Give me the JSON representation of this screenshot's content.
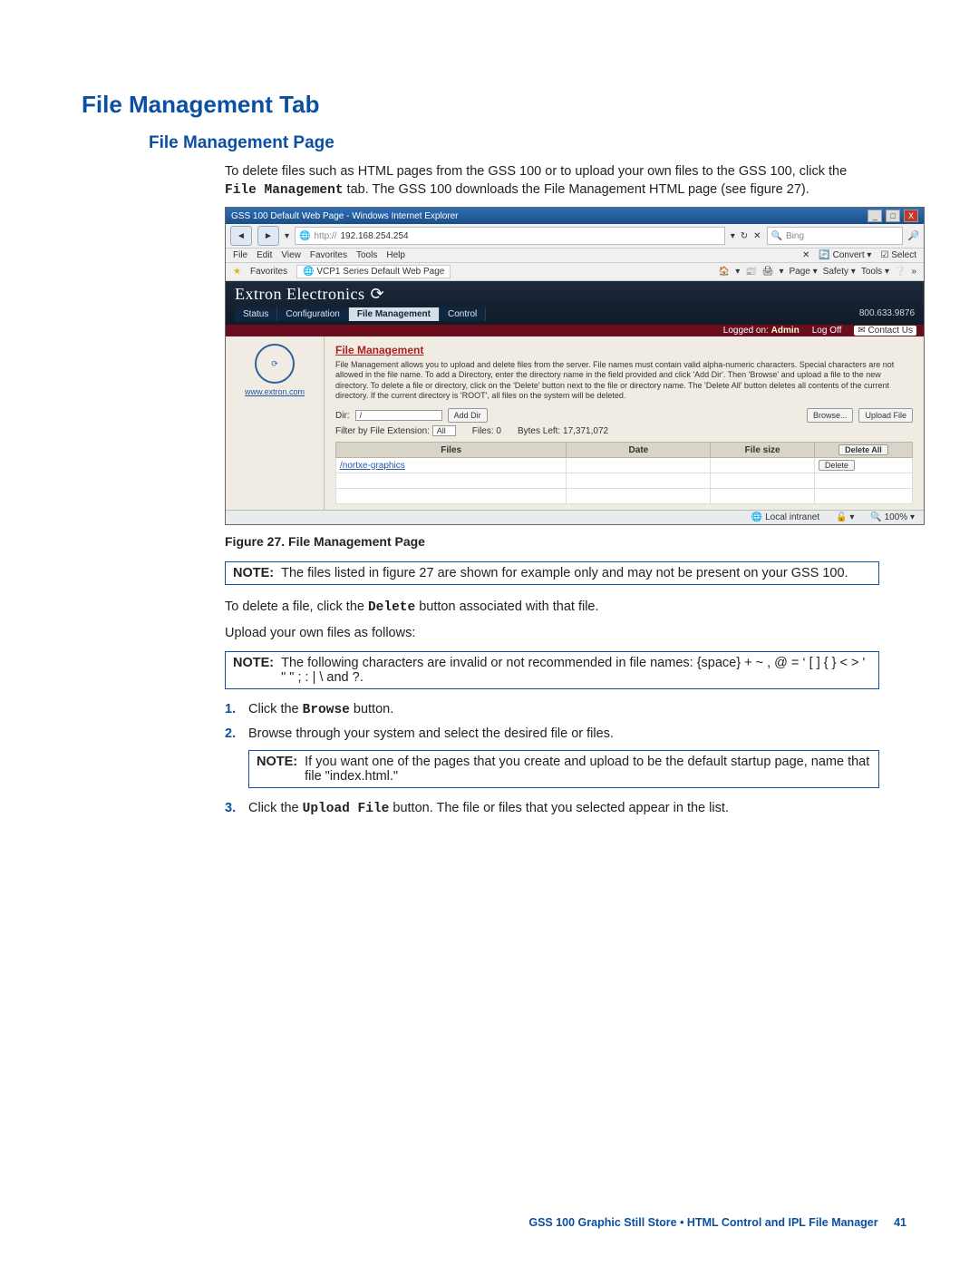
{
  "heading": "File Management Tab",
  "subheading": "File Management Page",
  "intro": {
    "part1": "To delete files such as HTML pages from the GSS 100 or to upload your own files to the GSS 100, click the ",
    "code": "File Management",
    "part2": " tab. The GSS 100 downloads the File Management HTML page (see figure 27)."
  },
  "screenshot": {
    "window_title": "GSS 100 Default Web Page - Windows Internet Explorer",
    "win_buttons": [
      "_",
      "□",
      "X"
    ],
    "address_prefix": "http://",
    "address": "192.168.254.254",
    "nav_icons": {
      "back": "◄",
      "fwd": "►",
      "refresh": "↻",
      "dropdown": "▾",
      "go": "→"
    },
    "search_icon": "🔍",
    "search_placeholder": "Bing",
    "search_go": "🔎",
    "menubar": [
      "File",
      "Edit",
      "View",
      "Favorites",
      "Tools",
      "Help"
    ],
    "toolbar_x": "✕",
    "toolbar_convert": "Convert",
    "toolbar_select": "Select",
    "fav_star": "★",
    "fav_label": "Favorites",
    "tab_icon": "🌐",
    "tab_title": "VCP1 Series Default Web Page",
    "tool_right": [
      "🏠",
      "▾",
      "📰",
      "",
      "🖨",
      "▾",
      "Page ▾",
      "Safety ▾",
      "Tools ▾",
      "❔",
      "»"
    ],
    "brand": "Extron Electronics",
    "brand_icon": "⟳",
    "tabs": [
      "Status",
      "Configuration",
      "File Management",
      "Control"
    ],
    "phone": "800.633.9876",
    "logged_label": "Logged on:",
    "logged_user": "Admin",
    "logoff": "Log Off",
    "contact_icon": "✉",
    "contact": "Contact Us",
    "sidebar_link": "www.extron.com",
    "panel_title": "File Management",
    "panel_desc": "File Management allows you to upload and delete files from the server. File names must contain valid alpha-numeric characters. Special characters are not allowed in the file name. To add a Directory, enter the directory name in the field provided and click 'Add Dir'. Then 'Browse' and upload a file to the new directory. To delete a file or directory, click on the 'Delete' button next to the file or directory name. The 'Delete All' button deletes all contents of the current directory. If the current directory is 'ROOT', all files on the system will be deleted.",
    "dir_label": "Dir:",
    "dir_value": "/",
    "add_dir": "Add Dir",
    "browse": "Browse...",
    "upload": "Upload File",
    "filter_label": "Filter by File Extension:",
    "filter_value": "All",
    "files_label": "Files:",
    "files_count": "0",
    "bytes_label": "Bytes Left:",
    "bytes_value": "17,371,072",
    "table_headers": [
      "Files",
      "Date",
      "File size",
      ""
    ],
    "delete_all": "Delete All",
    "row_link": "/nortxe-graphics",
    "row_btn": "Delete",
    "status_left_icon": "🌐",
    "status_left": "Local intranet",
    "status_mode_icon": "🔓",
    "status_mode": "▾",
    "status_zoom": "🔍 100% ▾"
  },
  "fig_caption": "Figure 27. File Management Page",
  "note1": {
    "label": "NOTE:",
    "text": "The files listed in figure 27 are shown for example only and may not be present on your GSS 100."
  },
  "delete_line": {
    "pre": "To delete a file, click the ",
    "code": "Delete",
    "post": " button associated with that file."
  },
  "upload_line": "Upload your own files as follows:",
  "note2": {
    "label": "NOTE:",
    "text": "The following characters are invalid or not recommended in file names: {space} + ~ , @ = ‘ [ ] { } < > ' \" \" ; : | \\ and ?."
  },
  "steps": {
    "s1_pre": "Click the ",
    "s1_code": "Browse",
    "s1_post": " button.",
    "s2": "Browse through your system and select the desired file or files.",
    "s3_pre": "Click the ",
    "s3_code": "Upload File",
    "s3_post": " button. The file or files that you selected appear in the list."
  },
  "note3": {
    "label": "NOTE:",
    "text": "If you want one of the pages that you create and upload to be the default startup page, name that file \"index.html.\""
  },
  "footer": {
    "text": "GSS 100 Graphic Still Store • HTML Control and IPL File Manager",
    "page": "41"
  }
}
